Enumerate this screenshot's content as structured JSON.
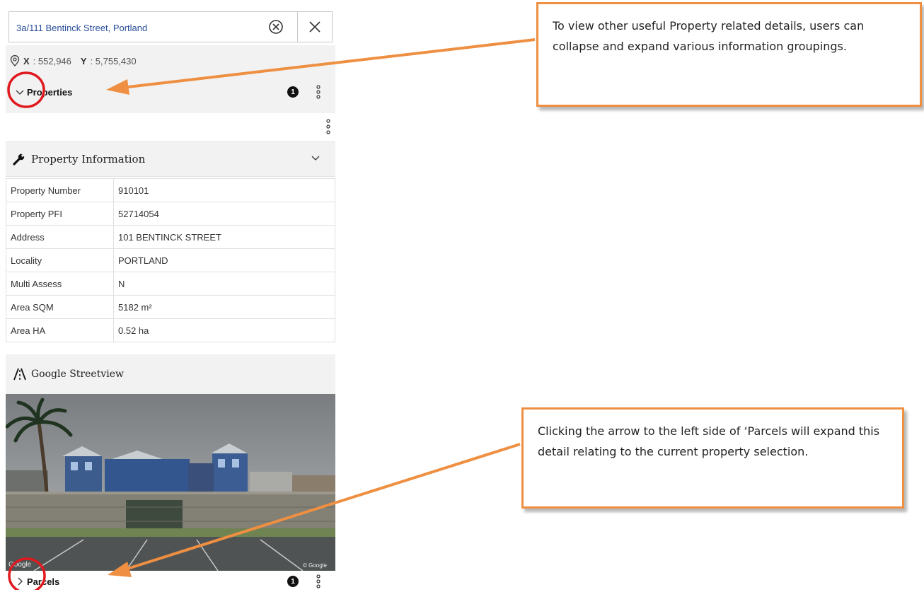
{
  "search": {
    "value": "3a/111 Bentinck Street, Portland",
    "clear_icon": "circle-x-icon",
    "close_icon": "close-icon"
  },
  "coordinates": {
    "icon": "location-pin-icon",
    "x_label": "X",
    "x_value": ": 552,946",
    "y_label": "Y",
    "y_value": ": 5,755,430"
  },
  "properties_section": {
    "title": "Properties",
    "count": "1",
    "icon": "chevron-down-icon"
  },
  "property_information": {
    "title": "Property Information",
    "icon": "wrench-icon",
    "rows": [
      {
        "label": "Property Number",
        "value": "910101"
      },
      {
        "label": "Property PFI",
        "value": "52714054"
      },
      {
        "label": "Address",
        "value": "101 BENTINCK STREET"
      },
      {
        "label": "Locality",
        "value": "PORTLAND"
      },
      {
        "label": "Multi Assess",
        "value": "N"
      },
      {
        "label": "Area SQM",
        "value": "5182 m²"
      },
      {
        "label": "Area HA",
        "value": "0.52 ha"
      }
    ]
  },
  "streetview": {
    "title": "Google Streetview",
    "icon": "road-icon",
    "watermark_left": "Google",
    "watermark_right": "© Google"
  },
  "parcels_section": {
    "title": "Parcels",
    "count": "1",
    "icon": "chevron-right-icon"
  },
  "callouts": {
    "top_text": "To view other useful Property related details, users can collapse and expand various information groupings.",
    "bottom_text": "Clicking the arrow to the left side of ‘Parcels will expand this detail relating to the current property selection."
  },
  "colors": {
    "accent_arrow": "#ee8f41",
    "highlight_circle": "#e0191e",
    "search_text": "#2a4e9b"
  }
}
